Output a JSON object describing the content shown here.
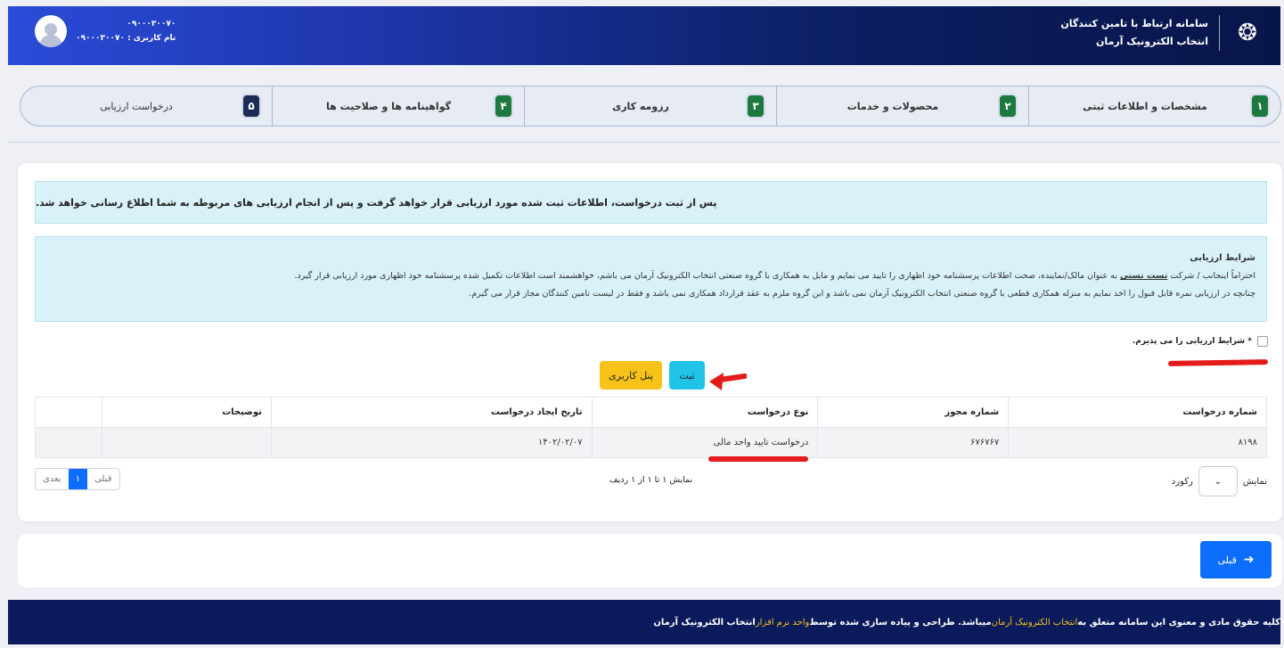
{
  "header": {
    "title": "سامانه ارتباط با تامین کنندگان",
    "subtitle": "انتخاب الکترونیک آرمان",
    "user_phone": "۰۹۰۰۰۳۰۰۷۰",
    "username_label": "نام کاربری : ۰۹۰۰۰۳۰۰۷۰"
  },
  "steps": [
    {
      "num": "۱",
      "label": "مشخصات و اطلاعات ثبتی",
      "state": "done"
    },
    {
      "num": "۲",
      "label": "محصولات و خدمات",
      "state": "done"
    },
    {
      "num": "۳",
      "label": "رزومه کاری",
      "state": "done"
    },
    {
      "num": "۴",
      "label": "گواهینامه ها و صلاحیت ها",
      "state": "done"
    },
    {
      "num": "۵",
      "label": "درخواست ارزیابی",
      "state": "current"
    }
  ],
  "notice": "پس از ثبت درخواست، اطلاعات ثبت شده مورد ارزیابی قرار خواهد گرفت و پس از انجام ارزیابی های مربوطه به شما اطلاع رسانی خواهد شد.",
  "conditions": {
    "title": "شرایط ارزیابی",
    "line1_pre": "احتراماً اینجانب / شرکت ",
    "line1_company": "تست تستی",
    "line1_post": " به عنوان مالک/نماینده، صحت اطلاعات پرسشنامه خود اظهاری را تایید می نمایم و مایل به همکاری با گروه صنعتی انتخاب الکترونیک آرمان می باشم، خواهشمند است اطلاعات تکمیل شده پرسشنامه خود اظهاری مورد ارزیابی قرار گیرد.",
    "line2": "چنانچه در ارزیابی نمره قابل قبول را اخذ نمایم به منزله همکاری قطعی با گروه صنعتی انتخاب الکترونیک آرمان نمی باشد و این گروه ملزم به عقد قرارداد همکاری نمی باشد و فقط در لیست تامین کنندگان مجاز قرار می گیرم."
  },
  "accept_label": "* شرایط ارزیابی را می پذیرم.",
  "buttons": {
    "submit": "ثبت",
    "panel": "پنل کاربری",
    "prev": "قبلی"
  },
  "table": {
    "headers": [
      "شماره درخواست",
      "شماره مجوز",
      "نوع درخواست",
      "تاریخ ایجاد درخواست",
      "توضیحات",
      ""
    ],
    "rows": [
      [
        "۸۱۹۸",
        "۶۷۶۷۶۷",
        "درخواست تایید واحد مالی",
        "۱۴۰۲/۰۲/۰۷",
        "",
        ""
      ]
    ]
  },
  "pagination": {
    "show_label": "نمایش",
    "record_label": "رکورد",
    "count_text": "نمایش ۱ تا ۱ از ۱ ردیف",
    "prev": "قبلی",
    "current": "۱",
    "next": "بعدی"
  },
  "footer": {
    "pre": "کلیه حقوق مادی و معنوی این سامانه متعلق به ",
    "org": "انتخاب الکترونیک آرمان",
    "mid": " میباشد. طراحی و پیاده سازی شده توسط ",
    "dept": "واحد نرم افزار",
    "post": " انتخاب الکترونیک آرمان"
  }
}
